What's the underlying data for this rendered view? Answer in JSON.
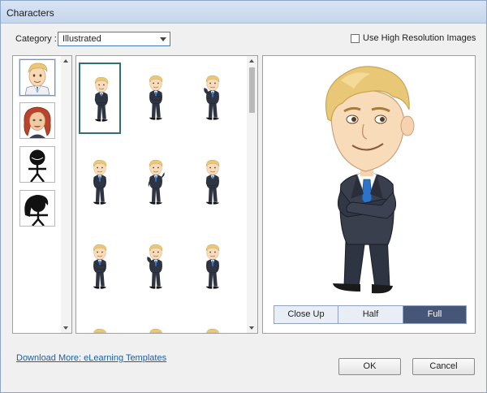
{
  "window": {
    "title": "Characters"
  },
  "category": {
    "label": "Category :",
    "selected": "Illustrated"
  },
  "high_res": {
    "label": "Use High Resolution Images",
    "checked": false
  },
  "characters": [
    {
      "icon": "businessman-icon",
      "selected": true
    },
    {
      "icon": "redhead-woman-icon",
      "selected": false
    },
    {
      "icon": "stick-figure-icon",
      "selected": false
    },
    {
      "icon": "stick-figure-hair-icon",
      "selected": false
    }
  ],
  "poses": {
    "rows_visible": 4,
    "columns": 3,
    "selected_index": 0
  },
  "view_modes": {
    "close_up": "Close Up",
    "half": "Half",
    "full": "Full",
    "selected": "Full"
  },
  "links": {
    "download_more": "Download More: eLearning Templates"
  },
  "buttons": {
    "ok": "OK",
    "cancel": "Cancel"
  },
  "colors": {
    "accent": "#465678",
    "selected_border": "#2e6f78",
    "link": "#1c5fa8",
    "suit": "#2f3442",
    "hair": "#e8c877",
    "tie": "#2c73c9"
  }
}
